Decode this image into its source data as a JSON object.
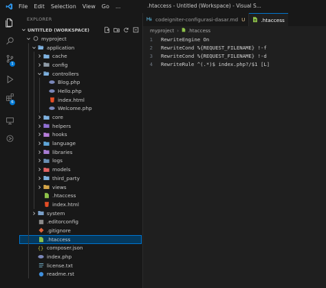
{
  "titlebar": {
    "menu": [
      "File",
      "Edit",
      "Selection",
      "View",
      "Go",
      "..."
    ],
    "window_title": ".htaccess - Untitled (Workspace) - Visual S..."
  },
  "activity": {
    "badges": [
      "1",
      "6"
    ]
  },
  "sidebar": {
    "title": "EXPLORER",
    "workspace": "UNTITLED (WORKSPACE)",
    "tree": [
      {
        "label": "myproject",
        "depth": 0,
        "kind": "root",
        "open": true
      },
      {
        "label": "application",
        "depth": 1,
        "kind": "folder",
        "open": true
      },
      {
        "label": "cache",
        "depth": 2,
        "kind": "folder"
      },
      {
        "label": "config",
        "depth": 2,
        "kind": "folder-config"
      },
      {
        "label": "controllers",
        "depth": 2,
        "kind": "folder",
        "open": true
      },
      {
        "label": "Blog.php",
        "depth": 3,
        "kind": "php"
      },
      {
        "label": "Hello.php",
        "depth": 3,
        "kind": "php"
      },
      {
        "label": "index.html",
        "depth": 3,
        "kind": "html"
      },
      {
        "label": "Welcome.php",
        "depth": 3,
        "kind": "php"
      },
      {
        "label": "core",
        "depth": 2,
        "kind": "folder"
      },
      {
        "label": "helpers",
        "depth": 2,
        "kind": "folder-helper"
      },
      {
        "label": "hooks",
        "depth": 2,
        "kind": "folder-hook"
      },
      {
        "label": "language",
        "depth": 2,
        "kind": "folder-lang"
      },
      {
        "label": "libraries",
        "depth": 2,
        "kind": "folder-lib"
      },
      {
        "label": "logs",
        "depth": 2,
        "kind": "folder-logs"
      },
      {
        "label": "models",
        "depth": 2,
        "kind": "folder-models"
      },
      {
        "label": "third_party",
        "depth": 2,
        "kind": "folder"
      },
      {
        "label": "views",
        "depth": 2,
        "kind": "folder-views"
      },
      {
        "label": ".htaccess",
        "depth": 2,
        "kind": "htaccess"
      },
      {
        "label": "index.html",
        "depth": 2,
        "kind": "html"
      },
      {
        "label": "system",
        "depth": 1,
        "kind": "folder-sys"
      },
      {
        "label": ".editorconfig",
        "depth": 1,
        "kind": "editorconfig"
      },
      {
        "label": ".gitignore",
        "depth": 1,
        "kind": "git"
      },
      {
        "label": ".htaccess",
        "depth": 1,
        "kind": "htaccess",
        "selected": true
      },
      {
        "label": "composer.json",
        "depth": 1,
        "kind": "json"
      },
      {
        "label": "index.php",
        "depth": 1,
        "kind": "php"
      },
      {
        "label": "license.txt",
        "depth": 1,
        "kind": "txt"
      },
      {
        "label": "readme.rst",
        "depth": 1,
        "kind": "rst"
      }
    ]
  },
  "editor": {
    "tabs": [
      {
        "label": "codeigniter-configurasi-dasar.md",
        "modified": "U",
        "active": false
      },
      {
        "label": ".htaccess",
        "active": true
      }
    ],
    "breadcrumb": [
      "myproject",
      ".htaccess"
    ],
    "lines": [
      {
        "n": "1",
        "text": "RewriteEngine On"
      },
      {
        "n": "2",
        "text": "RewriteCond %{REQUEST_FILENAME} !-f"
      },
      {
        "n": "3",
        "text": "RewriteCond %{REQUEST_FILENAME} !-d"
      },
      {
        "n": "4",
        "text": "RewriteRule ^(.*)$ index.php?/$1 [L]"
      }
    ]
  },
  "colors": {
    "accent": "#0078d4",
    "folder": "#7fb2e0",
    "php": "#7a86b8",
    "html": "#e44d26",
    "selection": "#04395e"
  }
}
